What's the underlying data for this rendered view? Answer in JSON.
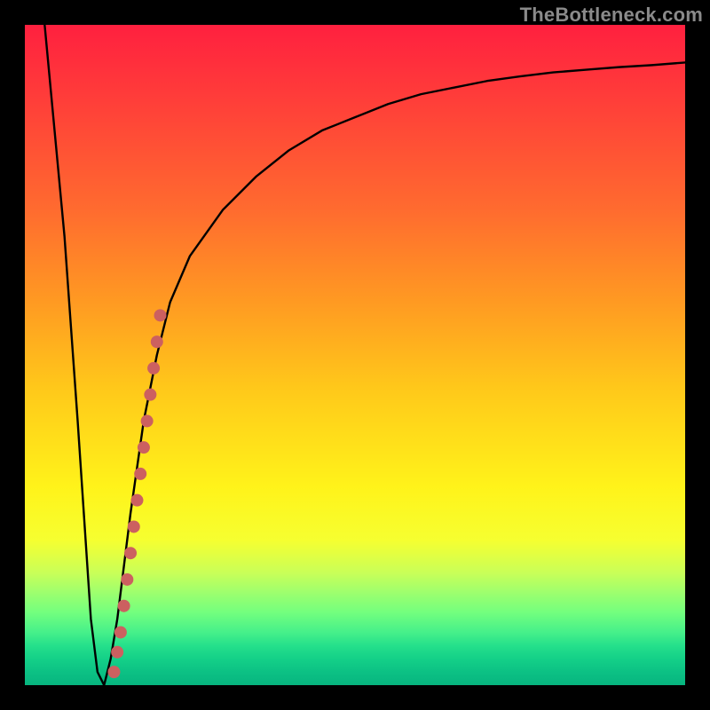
{
  "watermark": "TheBottleneck.com",
  "colors": {
    "frame": "#000000",
    "line": "#000000",
    "marker": "#cc6060",
    "gradient_top": "#ff203f",
    "gradient_bottom": "#07b57f"
  },
  "chart_data": {
    "type": "line",
    "title": "",
    "xlabel": "",
    "ylabel": "",
    "xlim": [
      0,
      100
    ],
    "ylim": [
      0,
      100
    ],
    "series": [
      {
        "name": "curve",
        "x": [
          3,
          6,
          8,
          10,
          11,
          12,
          13,
          14,
          16,
          18,
          20,
          22,
          25,
          30,
          35,
          40,
          45,
          50,
          55,
          60,
          65,
          70,
          75,
          80,
          85,
          90,
          95,
          100
        ],
        "y": [
          100,
          68,
          40,
          10,
          2,
          0,
          4,
          10,
          26,
          40,
          50,
          58,
          65,
          72,
          77,
          81,
          84,
          86,
          88,
          89.5,
          90.5,
          91.5,
          92.2,
          92.8,
          93.2,
          93.6,
          93.9,
          94.3
        ]
      },
      {
        "name": "markers",
        "x": [
          13.5,
          14.0,
          14.5,
          15.0,
          15.5,
          16.0,
          16.5,
          17.0,
          17.5,
          18.0,
          18.5,
          19.0,
          19.5,
          20.0,
          20.5
        ],
        "y": [
          2,
          5,
          8,
          12,
          16,
          20,
          24,
          28,
          32,
          36,
          40,
          44,
          48,
          52,
          56
        ]
      }
    ]
  }
}
